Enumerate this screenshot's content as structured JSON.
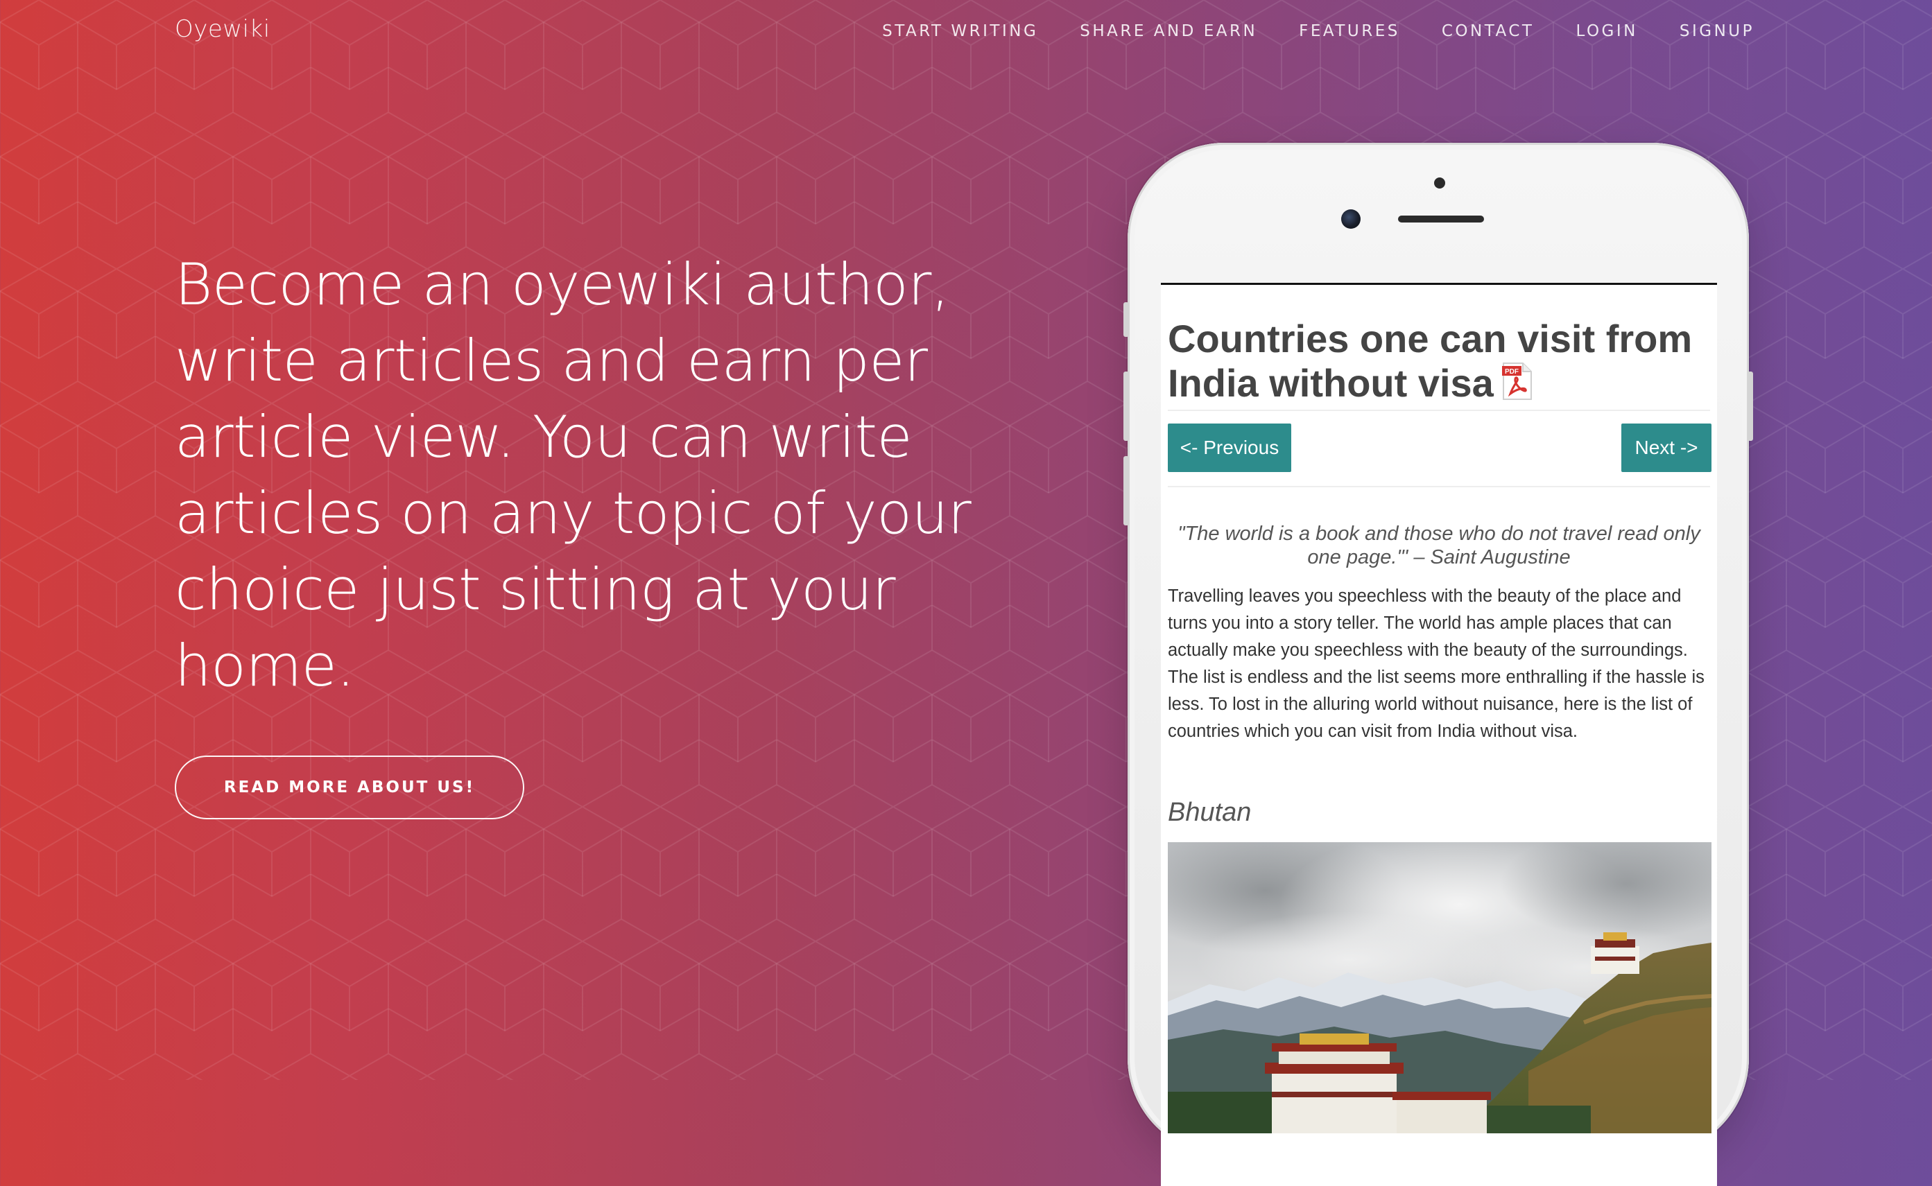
{
  "navbar": {
    "brand": "Oyewiki",
    "links": [
      "START WRITING",
      "SHARE AND EARN",
      "FEATURES",
      "CONTACT",
      "LOGIN",
      "SIGNUP"
    ]
  },
  "hero": {
    "heading": "Become an oyewiki author, write articles and earn per article view. You can write articles on any topic of your choice just sitting at your home.",
    "cta_label": "READ MORE ABOUT US!"
  },
  "phone_article": {
    "title": "Countries one can visit from India without visa",
    "pdf_icon_label": "PDF",
    "prev_label": "<- Previous",
    "next_label": "Next ->",
    "quote": "\"The world is a book and those who do not travel read only one page.\"' – Saint Augustine",
    "body": "Travelling leaves you speechless with the beauty of the place and turns you into a story teller. The world has ample places that can actually make you speechless with the beauty of the surroundings. The list is endless and the list seems more enthralling if the hassle is less. To lost in the alluring world without nuisance, here is the list of countries which you can visit from India without visa.",
    "section_heading": "Bhutan"
  },
  "colors": {
    "gradient_left": "#d13d3d",
    "gradient_right": "#6e4d9b",
    "button_teal": "#2d8c8c"
  }
}
